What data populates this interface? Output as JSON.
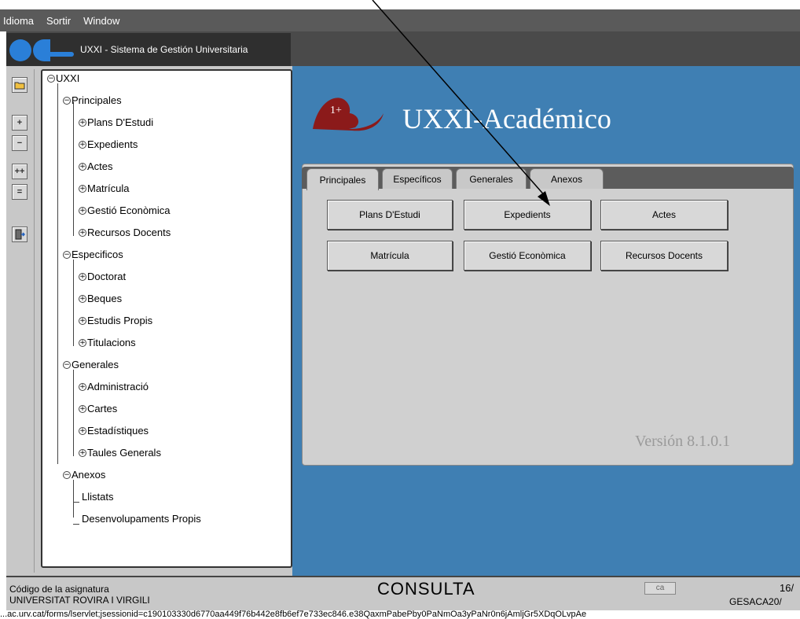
{
  "menubar": {
    "items": [
      {
        "label": "Idioma"
      },
      {
        "label": "Sortir"
      },
      {
        "label": "Window"
      }
    ]
  },
  "window": {
    "title": "UXXI - Sistema de Gestión Universitaria"
  },
  "tree": {
    "root": "UXXI",
    "groups": [
      {
        "label": "Principales",
        "items": [
          "Plans D'Estudi",
          "Expedients",
          "Actes",
          "Matrícula",
          "Gestió Econòmica",
          "Recursos Docents"
        ]
      },
      {
        "label": "Especificos",
        "items": [
          "Doctorat",
          "Beques",
          "Estudis Propis",
          "Titulacions"
        ]
      },
      {
        "label": "Generales",
        "items": [
          "Administració",
          "Cartes",
          "Estadístiques",
          "Taules Generals"
        ]
      },
      {
        "label": "Anexos",
        "items": [
          "Llistats",
          "Desenvolupaments Propis"
        ]
      }
    ]
  },
  "main": {
    "brand_title": "UXXI-Académico",
    "tabs": [
      {
        "label": "Principales"
      },
      {
        "label": "Específicos"
      },
      {
        "label": "Generales"
      },
      {
        "label": "Anexos"
      }
    ],
    "buttons": [
      {
        "label": "Plans D'Estudi"
      },
      {
        "label": "Expedients"
      },
      {
        "label": "Actes"
      },
      {
        "label": "Matrícula"
      },
      {
        "label": "Gestió Econòmica"
      },
      {
        "label": "Recursos Docents"
      }
    ],
    "version": "Versión 8.1.0.1"
  },
  "status": {
    "field_label": "Código de la asignatura",
    "university": "UNIVERSITAT ROVIRA I VIRGILI",
    "mode": "CONSULTA",
    "lang": "ca",
    "date_fragment": "16/",
    "code_fragment": "GESACA20/"
  },
  "url": "...ac.urv.cat/forms/lservlet;jsessionid=c190103330d6770aa449f76b442e8fb6ef7e733ec846.e38QaxmPabePby0PaNmOa3yPaNr0n6jAmljGr5XDqOLvpAe"
}
